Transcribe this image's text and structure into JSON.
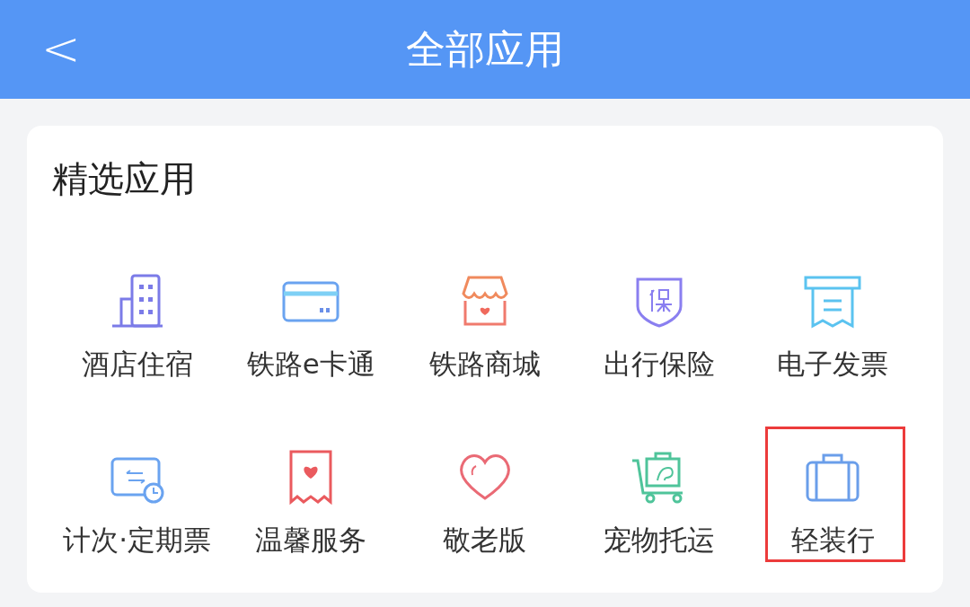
{
  "header": {
    "back": "<",
    "title": "全部应用"
  },
  "section": {
    "title": "精选应用",
    "apps": [
      {
        "label": "酒店住宿",
        "highlighted": false
      },
      {
        "label": "铁路e卡通",
        "highlighted": false
      },
      {
        "label": "铁路商城",
        "highlighted": false
      },
      {
        "label": "出行保险",
        "highlighted": false
      },
      {
        "label": "电子发票",
        "highlighted": false
      },
      {
        "label": "计次·定期票",
        "highlighted": false
      },
      {
        "label": "温馨服务",
        "highlighted": false
      },
      {
        "label": "敬老版",
        "highlighted": false
      },
      {
        "label": "宠物托运",
        "highlighted": false
      },
      {
        "label": "轻装行",
        "highlighted": true
      }
    ]
  }
}
